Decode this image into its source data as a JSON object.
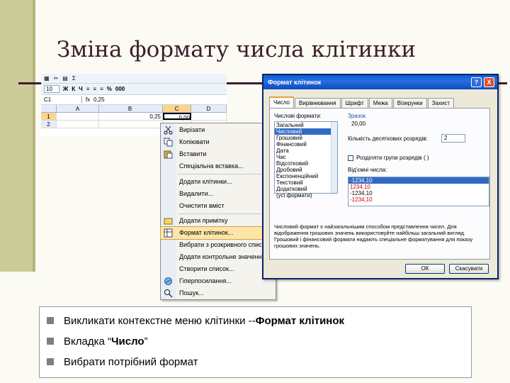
{
  "slide": {
    "title": "Зміна формату числа клітинки",
    "bullets": [
      {
        "text": "Викликати контекстне меню клітинки -- ",
        "bold": "Формат клітинок",
        "after": ""
      },
      {
        "text": "Вкладка “",
        "bold": "Число",
        "after": "”"
      },
      {
        "text": "Вибрати потрібний формат",
        "bold": "",
        "after": ""
      }
    ]
  },
  "excel": {
    "font_size": "10",
    "toolbar_glyphs": [
      "Ж",
      "К",
      "Ч",
      "%",
      "000"
    ],
    "name_box": "C1",
    "fx": "fx",
    "formula_value": "0,25",
    "columns": [
      "A",
      "B",
      "C",
      "D"
    ],
    "rows": [
      {
        "num": "1",
        "b": "0,25",
        "c": "0,00"
      },
      {
        "num": "2",
        "b": "",
        "c": ""
      }
    ]
  },
  "context_menu": {
    "items": [
      {
        "label": "Вирізати",
        "icon": "scissors-icon"
      },
      {
        "label": "Копіювати",
        "icon": "copy-icon"
      },
      {
        "label": "Вставити",
        "icon": "paste-icon"
      },
      {
        "label": "Спеціальна вставка...",
        "icon": ""
      },
      {
        "label": "Додати клітинки...",
        "icon": ""
      },
      {
        "label": "Видалити...",
        "icon": ""
      },
      {
        "label": "Очистити вміст",
        "icon": ""
      },
      {
        "label": "Додати примітку",
        "icon": "note-icon"
      },
      {
        "label": "Формат клітинок...",
        "icon": "format-icon"
      },
      {
        "label": "Вибрати з розкривного списку...",
        "icon": ""
      },
      {
        "label": "Додати контрольне значення",
        "icon": ""
      },
      {
        "label": "Створити список...",
        "icon": ""
      },
      {
        "label": "Гіперпосилання...",
        "icon": "hyperlink-icon"
      },
      {
        "label": "Пошук...",
        "icon": "search-icon"
      }
    ]
  },
  "dialog": {
    "title": "Формат клітинок",
    "help": "?",
    "close": "X",
    "tabs": [
      "Число",
      "Вирівнювання",
      "Шрифт",
      "Межа",
      "Візерунки",
      "Захист"
    ],
    "category_label": "Числові формати:",
    "categories": [
      "Загальний",
      "Числовий",
      "Грошовий",
      "Фінансовий",
      "Дата",
      "Час",
      "Відсотковий",
      "Дробовий",
      "Експоненційний",
      "Текстовий",
      "Додатковий",
      "(усі формати)"
    ],
    "selected_category": "Числовий",
    "sample_label": "Зразок",
    "sample_value": "20,00",
    "decimals_label": "Кількість десяткових розрядів:",
    "decimals_value": "2",
    "separator_label": "Розділяти групи розрядів ( )",
    "negative_label": "Від'ємні числа:",
    "negatives": [
      "-1234,10",
      "1234,10",
      "-1234,10",
      "-1234,10"
    ],
    "description": "Числовий формат є найзагальнішим способом представлення чисел. Для відображення грошових значень використовуйте найбільш загальний вигляд. Грошовий і фінансовий формати надають спеціальне форматування для показу грошових значень.",
    "ok": "ОК",
    "cancel": "Скасувати"
  },
  "colors": {
    "title": "#3b1f2b",
    "accent_bar": "#cccc99",
    "selection": "#316ac5",
    "negative_red": "#d00000"
  }
}
